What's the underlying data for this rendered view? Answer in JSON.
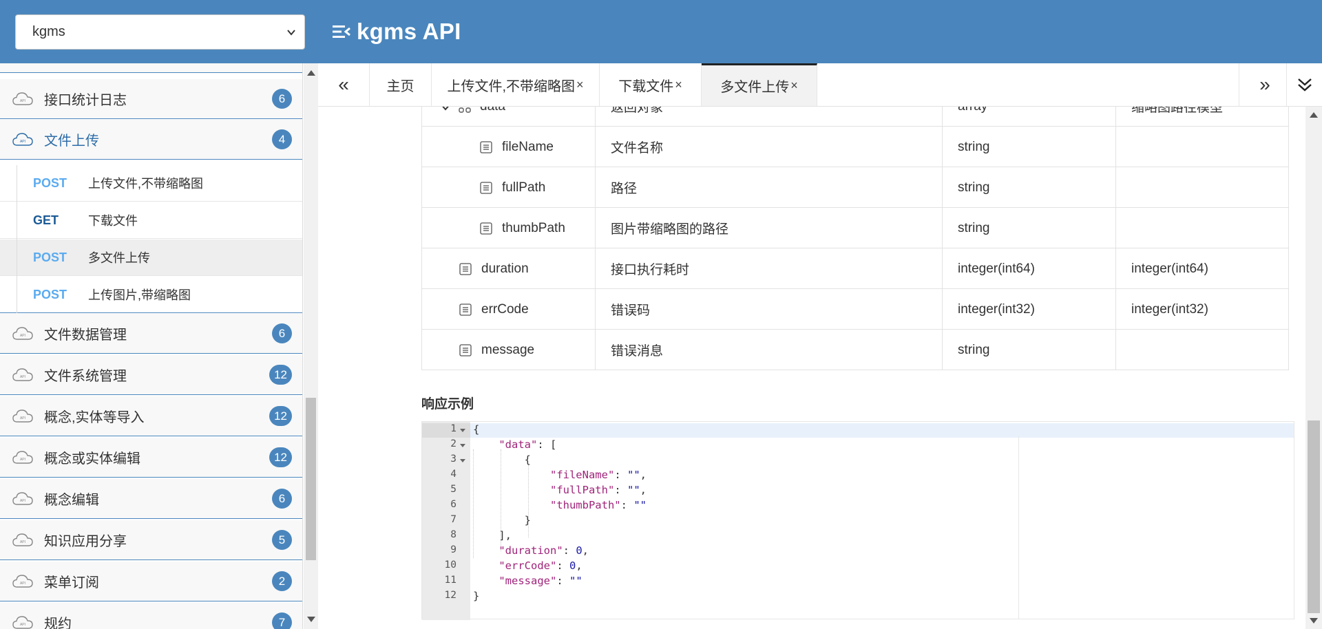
{
  "header": {
    "group_select": {
      "value": "kgms"
    },
    "title": "kgms API"
  },
  "sidebar": {
    "groups_before": [
      {
        "label": "接口统计日志",
        "count": "6",
        "active": false
      },
      {
        "label": "文件上传",
        "count": "4",
        "active": true
      }
    ],
    "apis": [
      {
        "method": "POST",
        "name": "上传文件,不带缩略图",
        "selected": false
      },
      {
        "method": "GET",
        "name": "下载文件",
        "selected": false
      },
      {
        "method": "POST",
        "name": "多文件上传",
        "selected": true
      },
      {
        "method": "POST",
        "name": "上传图片,带缩略图",
        "selected": false
      }
    ],
    "groups_after": [
      {
        "label": "文件数据管理",
        "count": "6"
      },
      {
        "label": "文件系统管理",
        "count": "12"
      },
      {
        "label": "概念,实体等导入",
        "count": "12"
      },
      {
        "label": "概念或实体编辑",
        "count": "12"
      },
      {
        "label": "概念编辑",
        "count": "6"
      },
      {
        "label": "知识应用分享",
        "count": "5"
      },
      {
        "label": "菜单订阅",
        "count": "2"
      },
      {
        "label": "规约",
        "count": "7"
      }
    ]
  },
  "tabs": {
    "prev_label": "«",
    "next_label": "»",
    "items": [
      {
        "label": "主页",
        "closable": false
      },
      {
        "label": "上传文件,不带缩略图",
        "closable": true
      },
      {
        "label": "下载文件",
        "closable": true
      },
      {
        "label": "多文件上传",
        "closable": true,
        "active": true
      }
    ],
    "close_glyph": "×"
  },
  "response_params": {
    "rows": [
      {
        "name": "data",
        "description": "返回对象",
        "type": "array",
        "schema": "缩略图路径模型",
        "level": 0,
        "expandable": true
      },
      {
        "name": "fileName",
        "description": "文件名称",
        "type": "string",
        "schema": "",
        "level": 1
      },
      {
        "name": "fullPath",
        "description": "路径",
        "type": "string",
        "schema": "",
        "level": 1
      },
      {
        "name": "thumbPath",
        "description": "图片带缩略图的路径",
        "type": "string",
        "schema": "",
        "level": 1
      },
      {
        "name": "duration",
        "description": "接口执行耗时",
        "type": "integer(int64)",
        "schema": "integer(int64)",
        "level": 0
      },
      {
        "name": "errCode",
        "description": "错误码",
        "type": "integer(int32)",
        "schema": "integer(int32)",
        "level": 0
      },
      {
        "name": "message",
        "description": "错误消息",
        "type": "string",
        "schema": "",
        "level": 0
      }
    ]
  },
  "response_example": {
    "title": "响应示例",
    "line_numbers": [
      "1",
      "2",
      "3",
      "4",
      "5",
      "6",
      "7",
      "8",
      "9",
      "10",
      "11",
      "12"
    ],
    "lines": [
      "{",
      "    \"data\": [",
      "        {",
      "            \"fileName\": \"\",",
      "            \"fullPath\": \"\",",
      "            \"thumbPath\": \"\"",
      "        }",
      "    ],",
      "    \"duration\": 0,",
      "    \"errCode\": 0,",
      "    \"message\": \"\"",
      "}"
    ]
  }
}
